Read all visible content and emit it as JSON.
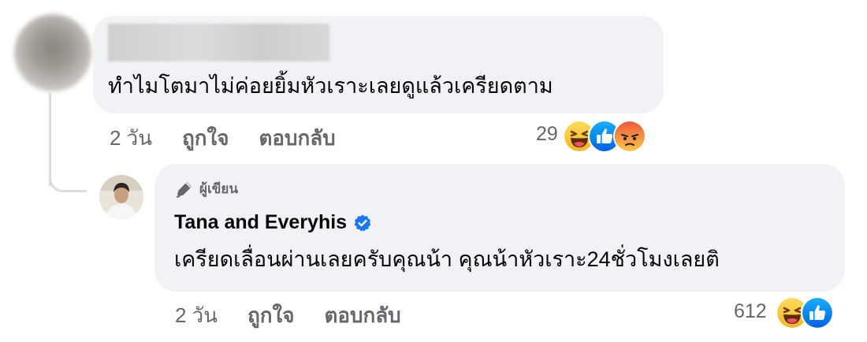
{
  "comment": {
    "text": "ทำไมโตมาไม่ค่อยยิ้มหัวเราะเลยดูแล้วเครียดตาม",
    "time": "2 วัน",
    "like_label": "ถูกใจ",
    "reply_label": "ตอบกลับ",
    "reaction_count": "29",
    "reactions": [
      "haha-icon",
      "like-icon",
      "angry-icon"
    ]
  },
  "reply": {
    "badge_label": "ผู้เขียน",
    "author_name": "Tana and Everyhis",
    "verified": true,
    "text": "เครียดเลื่อนผ่านเลยครับคุณน้า คุณน้าหัวเราะ24ชั่วโมงเลยติ",
    "time": "2 วัน",
    "like_label": "ถูกใจ",
    "reply_label": "ตอบกลับ",
    "reaction_count": "612",
    "reactions": [
      "haha-icon",
      "like-icon"
    ]
  },
  "colors": {
    "bubble": "#f0f2f5",
    "muted_text": "#65676b",
    "verified_blue": "#1877f2",
    "thread_line": "#d9dce1"
  }
}
